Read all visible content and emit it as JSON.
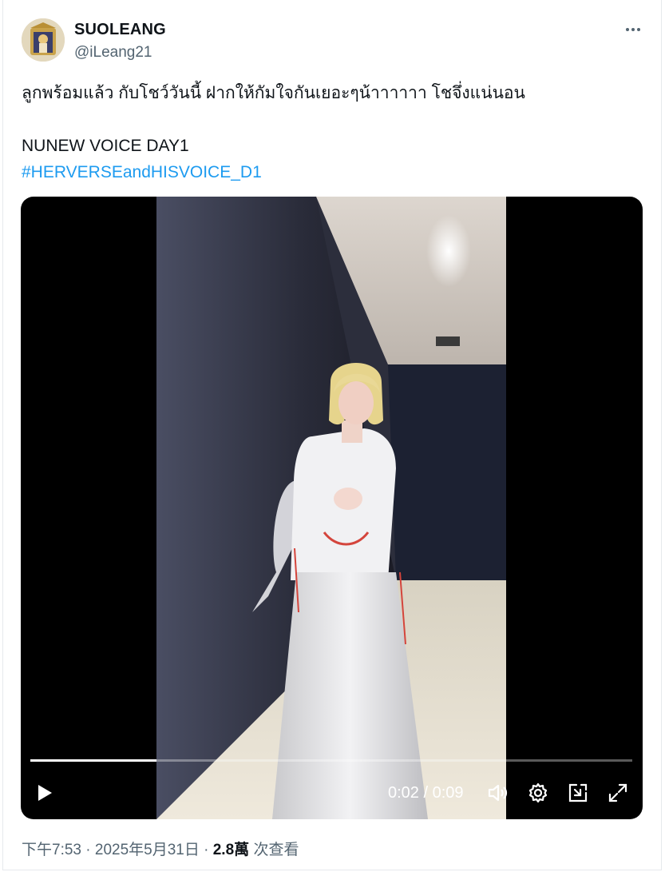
{
  "author": {
    "name": "SUOLEANG",
    "handle": "@iLeang21"
  },
  "tweet": {
    "line1": "ลูกพร้อมแล้ว กับโชว์วันนี้ ฝากให้กัมใจกันเยอะๆน้าาาาาา โชจึ่งแน่นอน",
    "line2": "NUNEW VOICE DAY1",
    "hashtag": "#HERVERSEandHISVOICE_D1"
  },
  "video": {
    "current_time": "0:02",
    "separator": " / ",
    "duration": "0:09",
    "progress": 0.21,
    "controls": [
      "play-icon",
      "volume-icon",
      "settings-icon",
      "pip-icon",
      "fullscreen-icon"
    ]
  },
  "meta": {
    "time": "下午7:53",
    "date": "2025年5月31日",
    "views": "2.8萬",
    "views_label": "次查看",
    "dot": " · "
  },
  "colors": {
    "accent": "#1d9bf0",
    "secondary_text": "#536471",
    "primary_text": "#0f1419"
  }
}
